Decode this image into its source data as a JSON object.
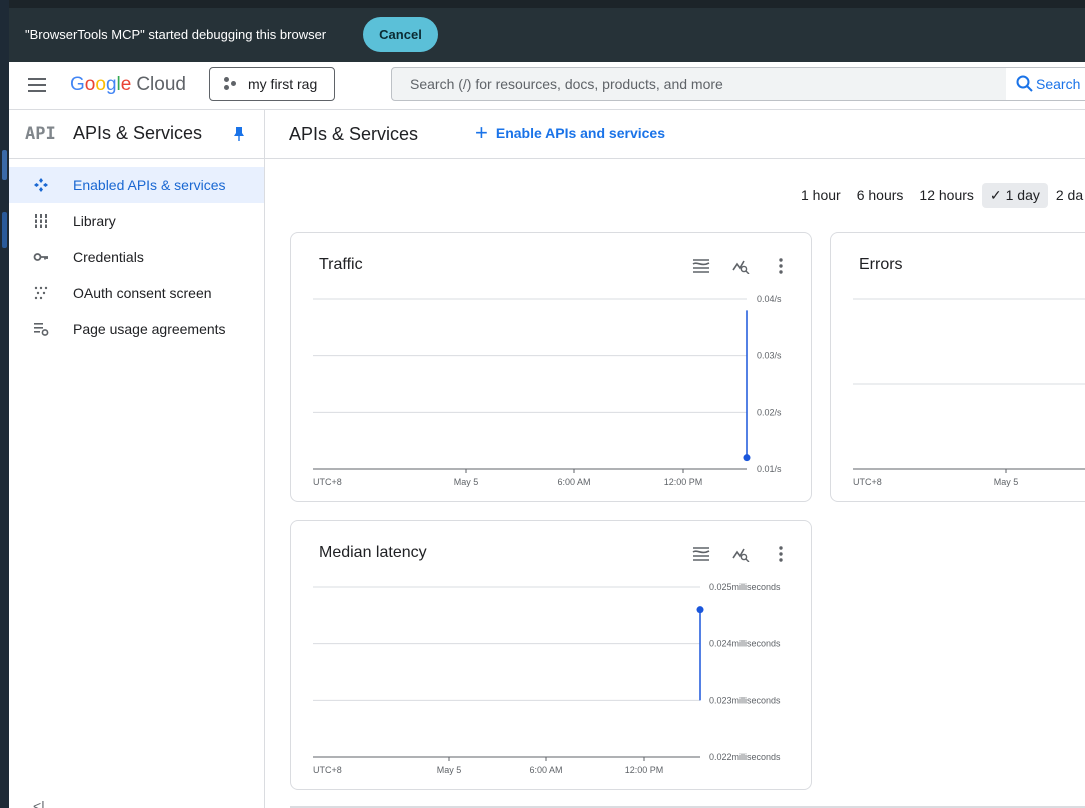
{
  "debug_banner": {
    "message": "\"BrowserTools MCP\" started debugging this browser",
    "cancel_label": "Cancel"
  },
  "topbar": {
    "brand_letters": [
      "G",
      "o",
      "o",
      "g",
      "l",
      "e"
    ],
    "brand_suffix": "Cloud",
    "project_name": "my first rag",
    "search_placeholder": "Search (/) for resources, docs, products, and more",
    "search_button_label": "Search"
  },
  "sidebar": {
    "badge": "API",
    "title": "APIs & Services",
    "items": [
      {
        "label": "Enabled APIs & services",
        "icon": "enabled-apis-icon",
        "active": true
      },
      {
        "label": "Library",
        "icon": "library-icon",
        "active": false
      },
      {
        "label": "Credentials",
        "icon": "key-icon",
        "active": false
      },
      {
        "label": "OAuth consent screen",
        "icon": "oauth-icon",
        "active": false
      },
      {
        "label": "Page usage agreements",
        "icon": "settings-list-icon",
        "active": false
      }
    ],
    "collapse_glyph": "<|"
  },
  "main": {
    "title": "APIs & Services",
    "enable_button_label": "Enable APIs and services",
    "time_range": {
      "options": [
        "1 hour",
        "6 hours",
        "12 hours",
        "1 day",
        "2 da"
      ],
      "selected": "1 day"
    }
  },
  "colors": {
    "accent": "#1a73e8",
    "series": "#1a56db",
    "banner_bg": "#263238",
    "cancel_bg": "#5bc0d8",
    "active_nav_bg": "#e8f0fe"
  },
  "chart_data": [
    {
      "type": "line",
      "title": "Traffic",
      "x_ticks": [
        "UTC+8",
        "May 5",
        "6:00 AM",
        "12:00 PM"
      ],
      "y_ticks": [
        "0.04/s",
        "0.03/s",
        "0.02/s",
        "0.01/s"
      ],
      "ylim": [
        0.01,
        0.04
      ],
      "series": [
        {
          "values": [
            {
              "x": "~1:30 PM",
              "y": 0.038
            },
            {
              "x": "~1:30 PM",
              "y": 0.012
            }
          ],
          "point": {
            "x": "~1:30 PM",
            "y": 0.012
          }
        }
      ],
      "grid": true
    },
    {
      "type": "line",
      "title": "Errors",
      "x_ticks": [
        "UTC+8",
        "May 5"
      ],
      "y_ticks": [],
      "series": [],
      "grid": true
    },
    {
      "type": "line",
      "title": "Median latency",
      "x_ticks": [
        "UTC+8",
        "May 5",
        "6:00 AM",
        "12:00 PM"
      ],
      "y_ticks": [
        "0.025milliseconds",
        "0.024milliseconds",
        "0.023milliseconds",
        "0.022milliseconds"
      ],
      "ylim": [
        0.022,
        0.025
      ],
      "series": [
        {
          "values": [
            {
              "x": "~12:45 PM",
              "y": 0.0246
            },
            {
              "x": "~12:45 PM",
              "y": 0.023
            }
          ],
          "point": {
            "x": "~12:45 PM",
            "y": 0.0246
          }
        }
      ],
      "grid": true
    }
  ]
}
